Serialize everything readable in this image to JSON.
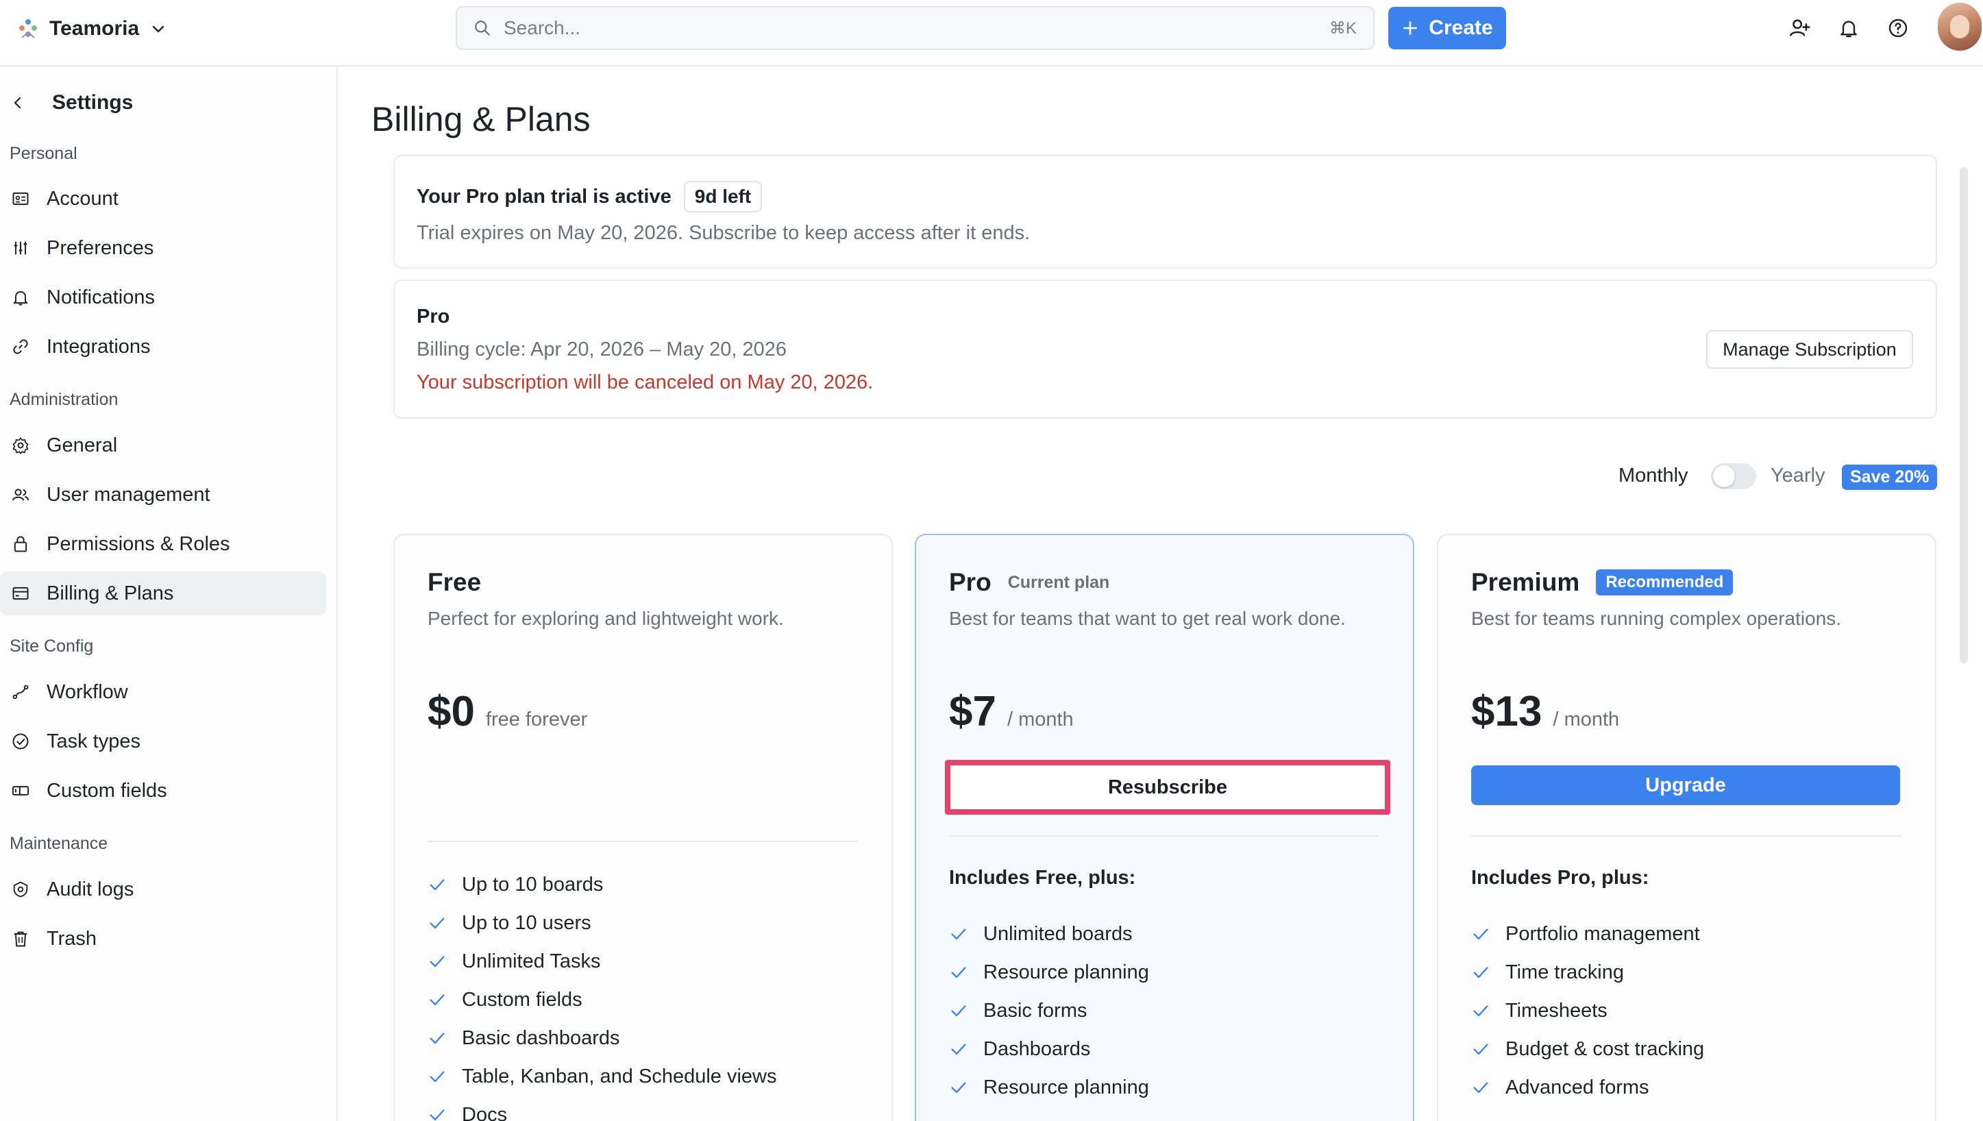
{
  "app": {
    "name": "Teamoria"
  },
  "search": {
    "placeholder": "Search...",
    "shortcut": "⌘K"
  },
  "header": {
    "create_label": "Create"
  },
  "sidebar": {
    "title": "Settings",
    "sections": [
      {
        "label": "Personal",
        "items": [
          {
            "label": "Account",
            "icon": "id-card-icon"
          },
          {
            "label": "Preferences",
            "icon": "sliders-icon"
          },
          {
            "label": "Notifications",
            "icon": "bell-icon"
          },
          {
            "label": "Integrations",
            "icon": "link-icon"
          }
        ]
      },
      {
        "label": "Administration",
        "items": [
          {
            "label": "General",
            "icon": "gear-icon"
          },
          {
            "label": "User management",
            "icon": "users-icon"
          },
          {
            "label": "Permissions & Roles",
            "icon": "lock-icon"
          },
          {
            "label": "Billing & Plans",
            "icon": "card-icon",
            "active": true
          }
        ]
      },
      {
        "label": "Site Config",
        "items": [
          {
            "label": "Workflow",
            "icon": "workflow-icon"
          },
          {
            "label": "Task types",
            "icon": "check-circle-icon"
          },
          {
            "label": "Custom fields",
            "icon": "field-icon"
          }
        ]
      },
      {
        "label": "Maintenance",
        "items": [
          {
            "label": "Audit logs",
            "icon": "shield-gear-icon"
          },
          {
            "label": "Trash",
            "icon": "trash-icon"
          }
        ]
      }
    ]
  },
  "main": {
    "title": "Billing & Plans",
    "trial": {
      "title": "Your Pro plan trial is active",
      "badge": "9d left",
      "note": "Trial expires on May 20, 2026. Subscribe to keep access after it ends."
    },
    "subscription": {
      "plan": "Pro",
      "cycle": "Billing cycle: Apr 20, 2026 – May 20, 2026",
      "warning": "Your subscription will be canceled on May 20, 2026.",
      "manage_label": "Manage Subscription"
    },
    "billing_toggle": {
      "monthly": "Monthly",
      "yearly": "Yearly",
      "save": "Save 20%",
      "yearly_enabled": false
    },
    "plans": [
      {
        "name": "Free",
        "desc": "Perfect for exploring and lightweight work.",
        "price": "$0",
        "period": "free forever",
        "features": [
          "Up to 10 boards",
          "Up to 10 users",
          "Unlimited Tasks",
          "Custom fields",
          "Basic dashboards",
          "Table, Kanban, and Schedule views",
          "Docs"
        ]
      },
      {
        "name": "Pro",
        "tag": "Current plan",
        "desc": "Best for teams that want to get real work done.",
        "price": "$7",
        "period": "/ month",
        "button": "Resubscribe",
        "includes": "Includes Free, plus:",
        "features": [
          "Unlimited boards",
          "Resource planning",
          "Basic forms",
          "Dashboards",
          "Resource planning"
        ]
      },
      {
        "name": "Premium",
        "tag": "Recommended",
        "desc": "Best for teams running complex operations.",
        "price": "$13",
        "period": "/ month",
        "button": "Upgrade",
        "includes": "Includes Pro, plus:",
        "features": [
          "Portfolio management",
          "Time tracking",
          "Timesheets",
          "Budget & cost tracking",
          "Advanced forms"
        ]
      }
    ]
  },
  "colors": {
    "accent": "#3b82ec",
    "danger": "#c0392b",
    "highlight": "#e4446b"
  }
}
